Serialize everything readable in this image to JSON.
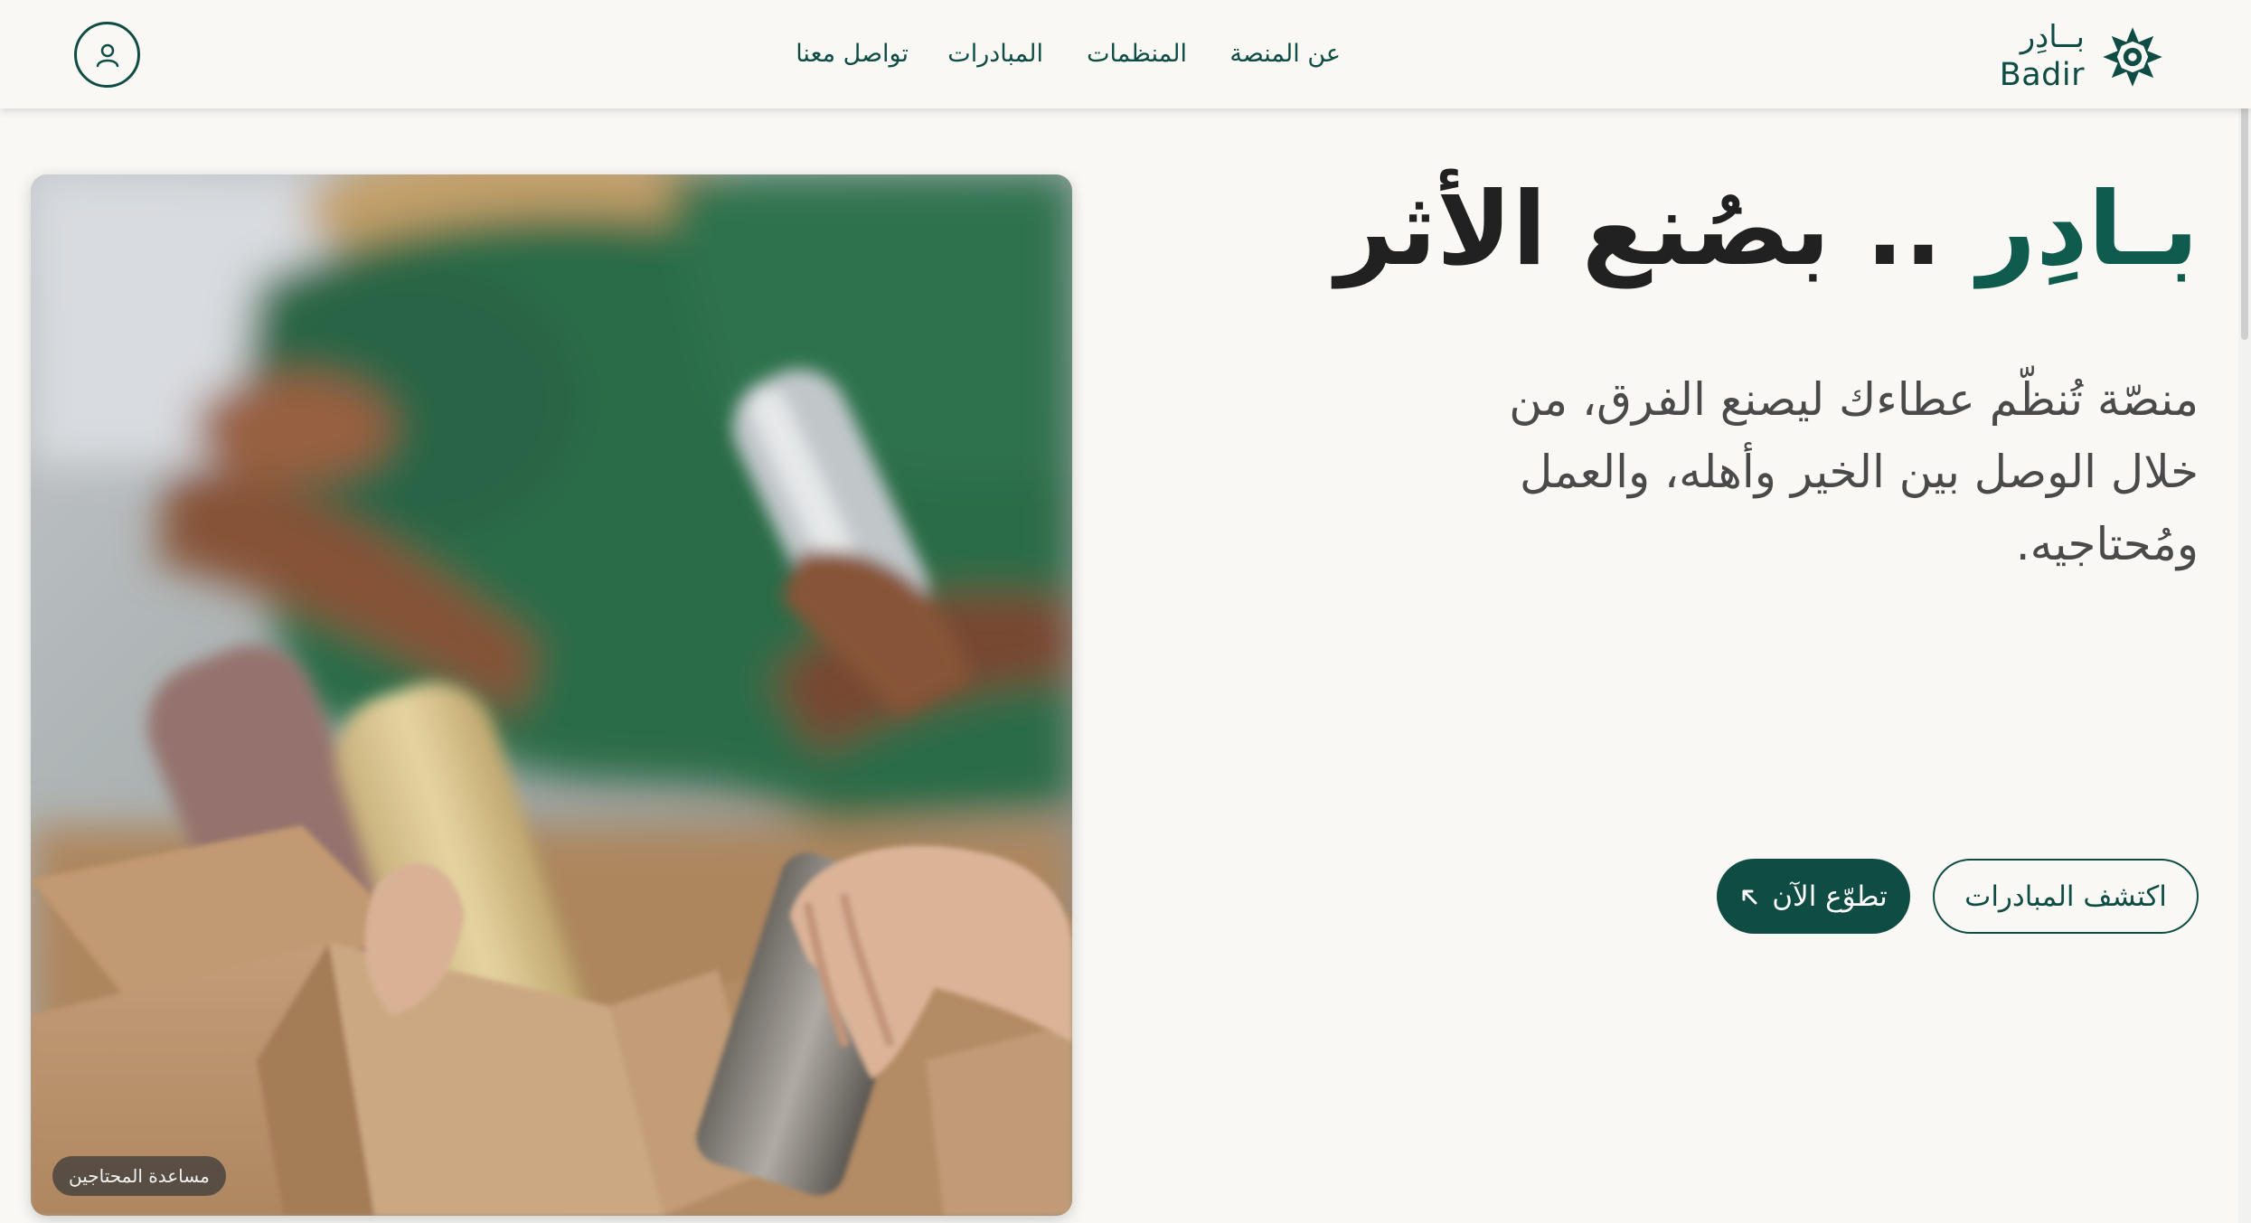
{
  "brand": {
    "name_ar": "بــادِر",
    "name_en": "Badir",
    "color": "#0f4d44"
  },
  "nav": {
    "about": "عن المنصة",
    "organizations": "المنظمات",
    "initiatives": "المبادرات",
    "contact": "تواصل معنا"
  },
  "header": {
    "profile_icon": "user-icon"
  },
  "hero": {
    "title_accent": "بـادِر",
    "title_rest": " .. بصُنع الأثر",
    "description": "منصّة تُنظّم عطاءك ليصنع الفرق، من خلال الوصل بين الخير وأهله، والعمل ومُحتاجيه.",
    "image_caption": "مساعدة المحتاجين",
    "buttons": {
      "discover": "اكتشف المبادرات",
      "volunteer": "تطوّع الآن",
      "volunteer_icon": "arrow-up-left-icon"
    }
  },
  "colors": {
    "accent": "#0f4d44",
    "background": "#f9f8f5",
    "title_text": "#212121",
    "body_text": "#4a4a4a"
  }
}
